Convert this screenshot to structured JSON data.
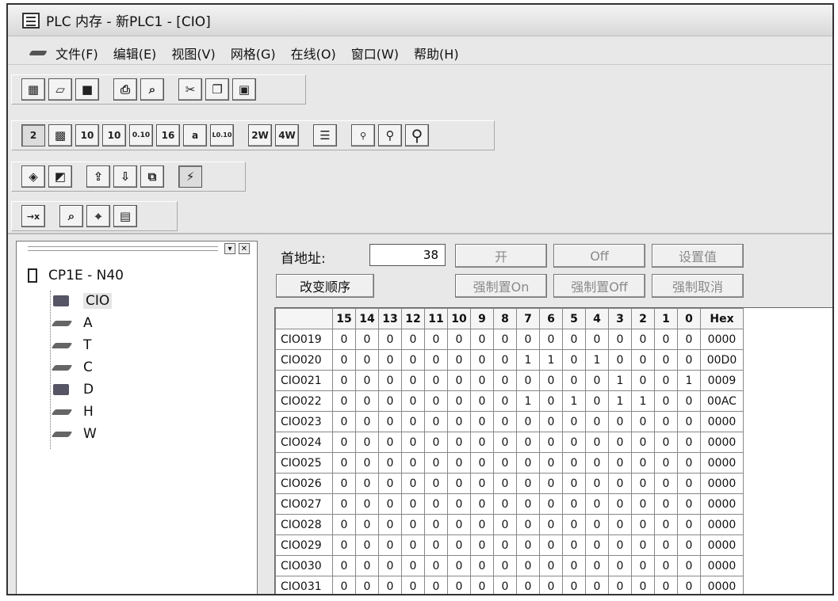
{
  "window": {
    "title": "PLC 内存 - 新PLC1 - [CIO]"
  },
  "menu": [
    "文件(F)",
    "编辑(E)",
    "视图(V)",
    "网格(G)",
    "在线(O)",
    "窗口(W)",
    "帮助(H)"
  ],
  "toolbar2": {
    "btn_2": "2",
    "btn_10": "10",
    "btn_10b": "10",
    "btn_010": "0.10",
    "btn_16": "16",
    "btn_a": "a",
    "btn_l010": "L0.10",
    "btn_2w": "2W",
    "btn_4w": "4W"
  },
  "tree": {
    "root": "CP1E - N40",
    "items": [
      "CIO",
      "A",
      "T",
      "C",
      "D",
      "H",
      "W"
    ]
  },
  "controls": {
    "start_address_label": "首地址:",
    "start_address_value": "38",
    "change_order": "改变顺序",
    "on": "开",
    "off": "Off",
    "set_value": "设置值",
    "force_on": "强制置On",
    "force_off": "强制置Off",
    "force_cancel": "强制取消"
  },
  "grid": {
    "headers": [
      "",
      "15",
      "14",
      "13",
      "12",
      "11",
      "10",
      "9",
      "8",
      "7",
      "6",
      "5",
      "4",
      "3",
      "2",
      "1",
      "0",
      "Hex"
    ],
    "rows": [
      {
        "addr": "CIO019",
        "bits": [
          "0",
          "0",
          "0",
          "0",
          "0",
          "0",
          "0",
          "0",
          "0",
          "0",
          "0",
          "0",
          "0",
          "0",
          "0",
          "0"
        ],
        "hex": "0000"
      },
      {
        "addr": "CIO020",
        "bits": [
          "0",
          "0",
          "0",
          "0",
          "0",
          "0",
          "0",
          "0",
          "1",
          "1",
          "0",
          "1",
          "0",
          "0",
          "0",
          "0"
        ],
        "hex": "00D0"
      },
      {
        "addr": "CIO021",
        "bits": [
          "0",
          "0",
          "0",
          "0",
          "0",
          "0",
          "0",
          "0",
          "0",
          "0",
          "0",
          "0",
          "1",
          "0",
          "0",
          "1"
        ],
        "hex": "0009"
      },
      {
        "addr": "CIO022",
        "bits": [
          "0",
          "0",
          "0",
          "0",
          "0",
          "0",
          "0",
          "0",
          "1",
          "0",
          "1",
          "0",
          "1",
          "1",
          "0",
          "0"
        ],
        "hex": "00AC"
      },
      {
        "addr": "CIO023",
        "bits": [
          "0",
          "0",
          "0",
          "0",
          "0",
          "0",
          "0",
          "0",
          "0",
          "0",
          "0",
          "0",
          "0",
          "0",
          "0",
          "0"
        ],
        "hex": "0000"
      },
      {
        "addr": "CIO024",
        "bits": [
          "0",
          "0",
          "0",
          "0",
          "0",
          "0",
          "0",
          "0",
          "0",
          "0",
          "0",
          "0",
          "0",
          "0",
          "0",
          "0"
        ],
        "hex": "0000"
      },
      {
        "addr": "CIO025",
        "bits": [
          "0",
          "0",
          "0",
          "0",
          "0",
          "0",
          "0",
          "0",
          "0",
          "0",
          "0",
          "0",
          "0",
          "0",
          "0",
          "0"
        ],
        "hex": "0000"
      },
      {
        "addr": "CIO026",
        "bits": [
          "0",
          "0",
          "0",
          "0",
          "0",
          "0",
          "0",
          "0",
          "0",
          "0",
          "0",
          "0",
          "0",
          "0",
          "0",
          "0"
        ],
        "hex": "0000"
      },
      {
        "addr": "CIO027",
        "bits": [
          "0",
          "0",
          "0",
          "0",
          "0",
          "0",
          "0",
          "0",
          "0",
          "0",
          "0",
          "0",
          "0",
          "0",
          "0",
          "0"
        ],
        "hex": "0000"
      },
      {
        "addr": "CIO028",
        "bits": [
          "0",
          "0",
          "0",
          "0",
          "0",
          "0",
          "0",
          "0",
          "0",
          "0",
          "0",
          "0",
          "0",
          "0",
          "0",
          "0"
        ],
        "hex": "0000"
      },
      {
        "addr": "CIO029",
        "bits": [
          "0",
          "0",
          "0",
          "0",
          "0",
          "0",
          "0",
          "0",
          "0",
          "0",
          "0",
          "0",
          "0",
          "0",
          "0",
          "0"
        ],
        "hex": "0000"
      },
      {
        "addr": "CIO030",
        "bits": [
          "0",
          "0",
          "0",
          "0",
          "0",
          "0",
          "0",
          "0",
          "0",
          "0",
          "0",
          "0",
          "0",
          "0",
          "0",
          "0"
        ],
        "hex": "0000"
      },
      {
        "addr": "CIO031",
        "bits": [
          "0",
          "0",
          "0",
          "0",
          "0",
          "0",
          "0",
          "0",
          "0",
          "0",
          "0",
          "0",
          "0",
          "0",
          "0",
          "0"
        ],
        "hex": "0000"
      }
    ]
  }
}
